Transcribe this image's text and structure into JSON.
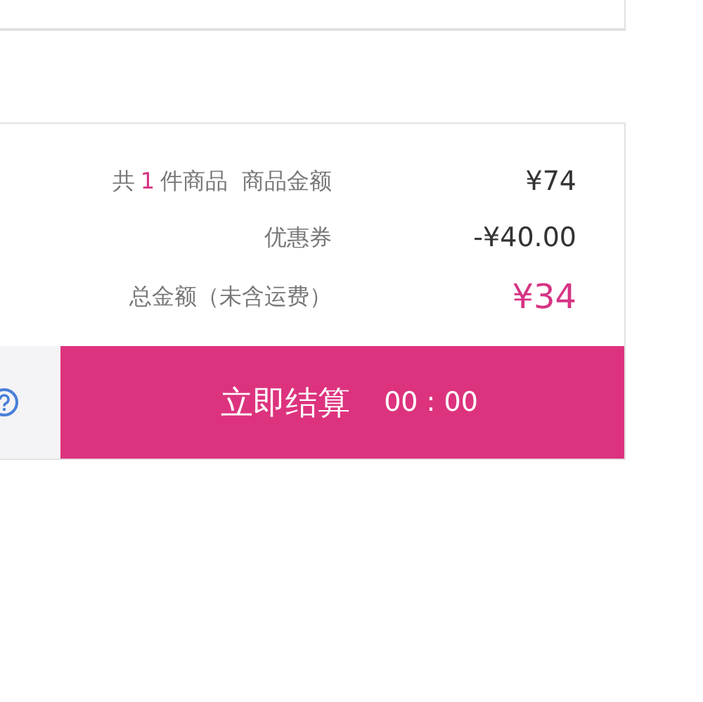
{
  "summary": {
    "rows": [
      {
        "kind": "count",
        "prefix": "共",
        "count": "1",
        "suffix": "件商品",
        "label": "商品金额",
        "value": "¥74"
      },
      {
        "kind": "plain",
        "label": "优惠券",
        "value": "-¥40.00"
      },
      {
        "kind": "total",
        "label": "总金额（未含运费）",
        "value": "¥34"
      }
    ]
  },
  "checkout": {
    "label": "立即结算",
    "timer": "00 : 00"
  }
}
